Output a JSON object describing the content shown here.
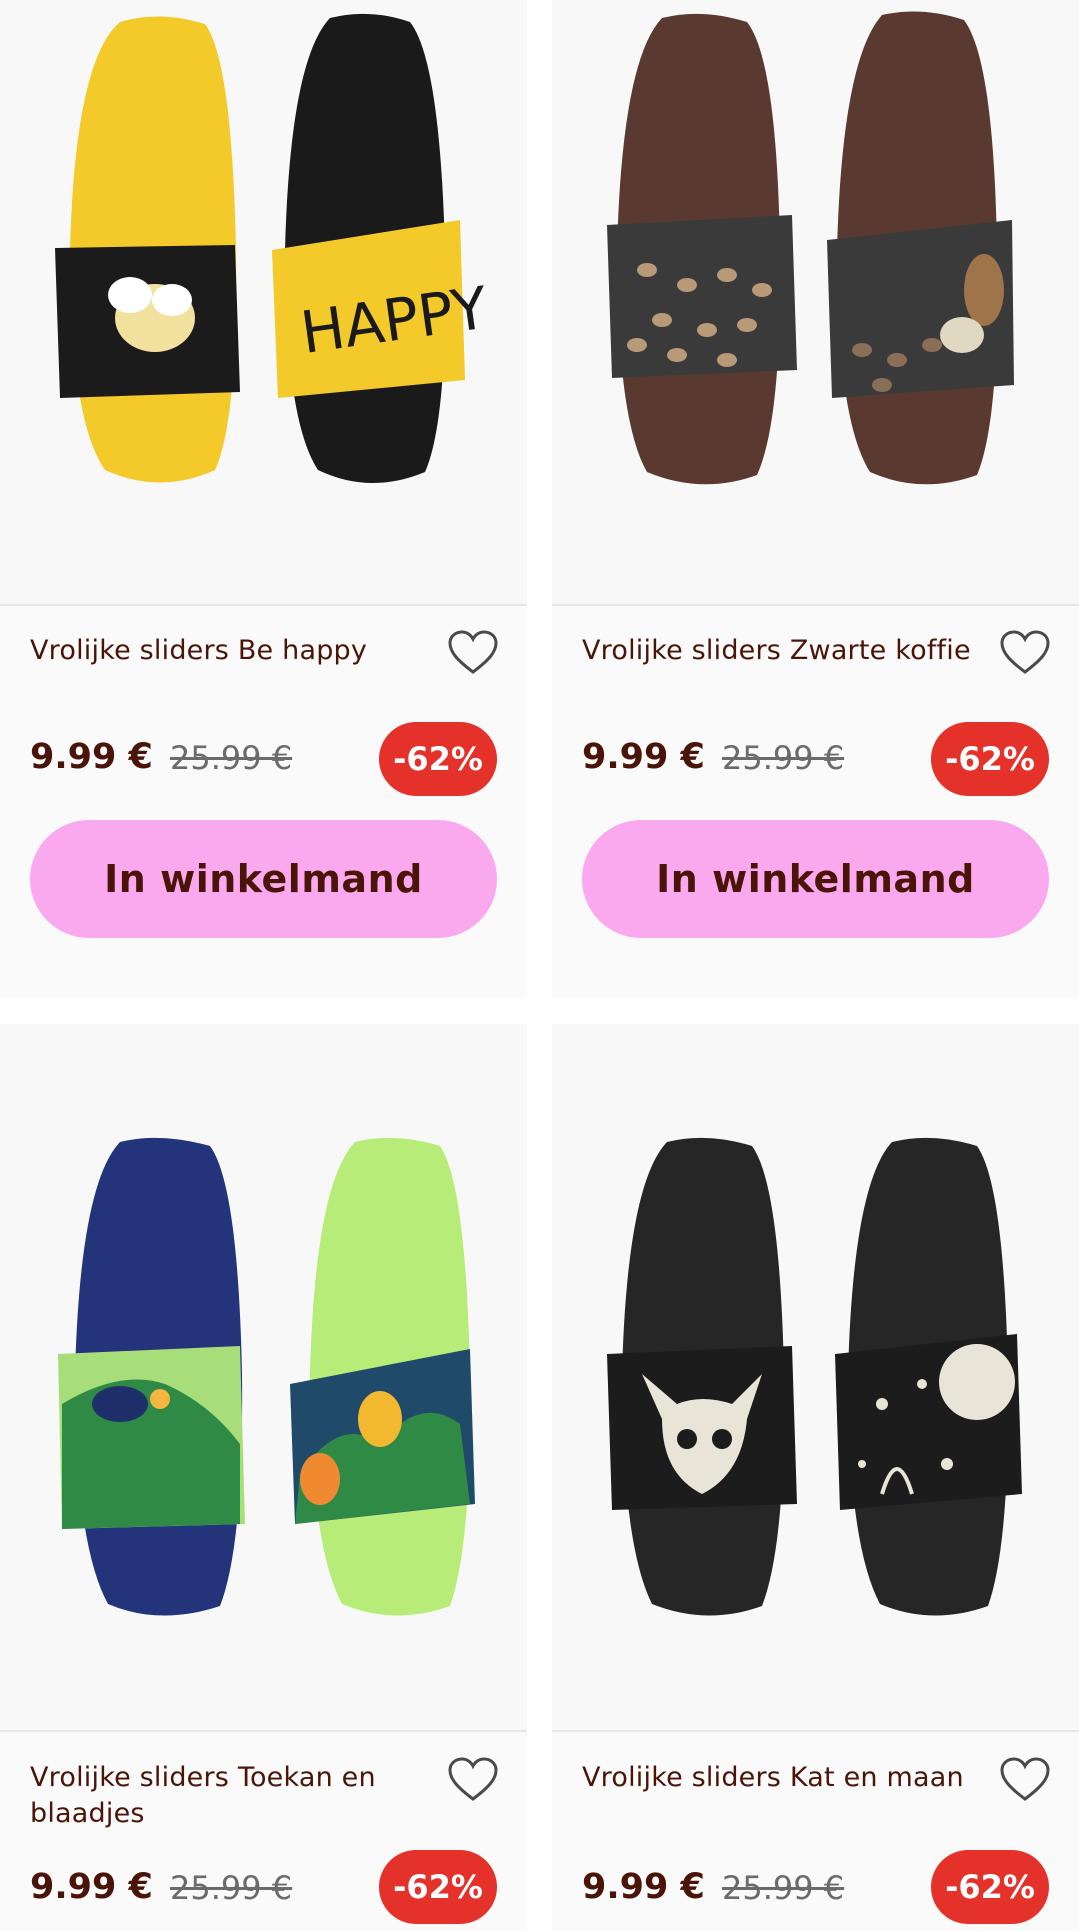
{
  "colors": {
    "text": "#4a1508",
    "badge": "#e4322b",
    "cart_button": "#fba9ef",
    "card_bg": "#fafafa"
  },
  "products": [
    {
      "title": "Vrolijke sliders Be happy",
      "price": "9.99 €",
      "old_price": "25.99 €",
      "discount": "-62%",
      "cart_label": "In winkelmand",
      "favorite_icon": "heart-outline-icon"
    },
    {
      "title": "Vrolijke sliders Zwarte koffie",
      "price": "9.99 €",
      "old_price": "25.99 €",
      "discount": "-62%",
      "cart_label": "In winkelmand",
      "favorite_icon": "heart-outline-icon"
    },
    {
      "title": "Vrolijke sliders Toekan en blaadjes",
      "price": "9.99 €",
      "old_price": "25.99 €",
      "discount": "-62%",
      "favorite_icon": "heart-outline-icon"
    },
    {
      "title": "Vrolijke sliders Kat en maan",
      "price": "9.99 €",
      "old_price": "25.99 €",
      "discount": "-62%",
      "favorite_icon": "heart-outline-icon"
    }
  ]
}
